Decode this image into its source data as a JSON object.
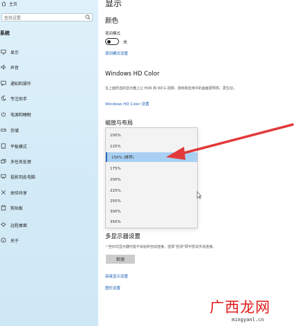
{
  "sidebar": {
    "home_label": "主页",
    "search_placeholder": "查找设置",
    "section_title": "系统",
    "items": [
      {
        "label": "显示",
        "icon": "monitor-icon"
      },
      {
        "label": "声音",
        "icon": "speaker-icon"
      },
      {
        "label": "通知和操作",
        "icon": "notification-icon"
      },
      {
        "label": "专注助手",
        "icon": "moon-icon"
      },
      {
        "label": "电源和睡眠",
        "icon": "power-icon"
      },
      {
        "label": "存储",
        "icon": "storage-icon"
      },
      {
        "label": "平板模式",
        "icon": "tablet-icon"
      },
      {
        "label": "多任务处理",
        "icon": "multitask-icon"
      },
      {
        "label": "投影到此电脑",
        "icon": "projector-icon"
      },
      {
        "label": "体验共享",
        "icon": "share-icon"
      },
      {
        "label": "剪贴板",
        "icon": "clipboard-icon"
      },
      {
        "label": "远程桌面",
        "icon": "remote-icon"
      },
      {
        "label": "关于",
        "icon": "info-icon"
      }
    ]
  },
  "main": {
    "page_title": "显示",
    "color_heading": "颜色",
    "night_light_label": "夜间模式",
    "night_light_state": "关",
    "night_light_link": "夜间模式设置",
    "hdr_heading": "Windows HD Color",
    "hdr_desc": "在上面所选的显示器上让 HDR 和 WCG 视频、游戏和应用中的画面更明亮、更生动。",
    "hdr_link": "Windows HD Color 设置",
    "scale_heading": "缩放与布局",
    "scale_options": [
      "100%",
      "125%",
      "150% (推荐)",
      "175%",
      "200%",
      "225%",
      "250%",
      "300%",
      "350%"
    ],
    "scale_selected_index": 2,
    "multi_heading": "多显示器设置",
    "multi_desc": "一些旧式显示器可能不会始终自动连接。选择“检测”即可尝试手动连接。",
    "detect_button": "检测",
    "adv_link": "高级显示设置",
    "graphics_link": "图形设置"
  },
  "watermark": {
    "logo": "广西龙网",
    "url": "mingyanl.cn"
  },
  "colors": {
    "sidebar_bg": "#d8eef9",
    "selected_item": "#a9d0f3",
    "link": "#1a5fb4",
    "arrow": "#e23a3a",
    "watermark": "#e21a1a"
  }
}
